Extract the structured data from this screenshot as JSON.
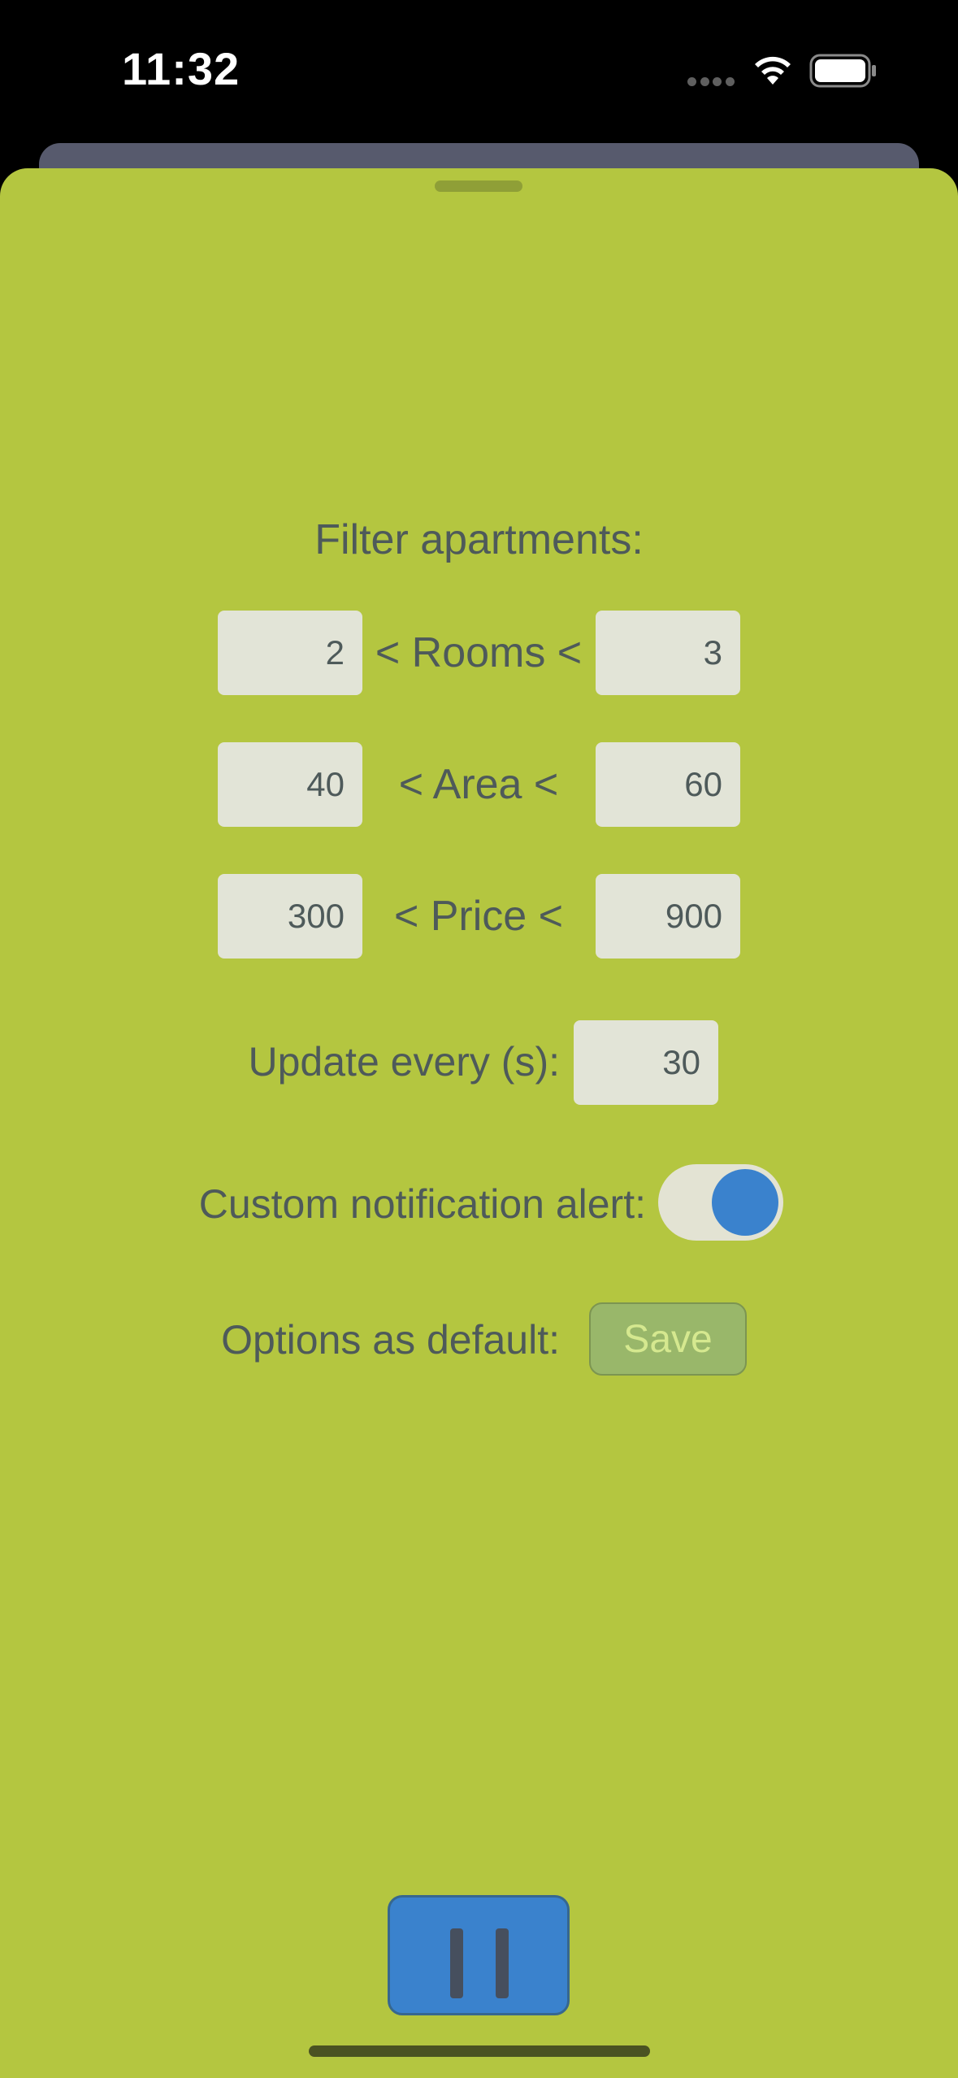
{
  "status_bar": {
    "time": "11:32",
    "icons": [
      "signal-dots-icon",
      "wifi-icon",
      "battery-icon"
    ]
  },
  "colors": {
    "sheet_background": "#b4c640",
    "text": "#4e5a5a",
    "field_background": "#e2e4d7",
    "accent_blue": "#3a82cd",
    "save_background": "#99b76a"
  },
  "filter": {
    "title": "Filter apartments:",
    "rows": [
      {
        "label": "< Rooms <",
        "min": "2",
        "max": "3"
      },
      {
        "label": "< Area <",
        "min": "40",
        "max": "60"
      },
      {
        "label": "< Price <",
        "min": "300",
        "max": "900"
      }
    ]
  },
  "update": {
    "label": "Update every (s):",
    "value": "30"
  },
  "notification": {
    "label": "Custom notification alert:",
    "enabled": true
  },
  "defaults": {
    "label": "Options as default:",
    "save_label": "Save"
  },
  "controls": {
    "pause_icon": "pause-icon"
  }
}
